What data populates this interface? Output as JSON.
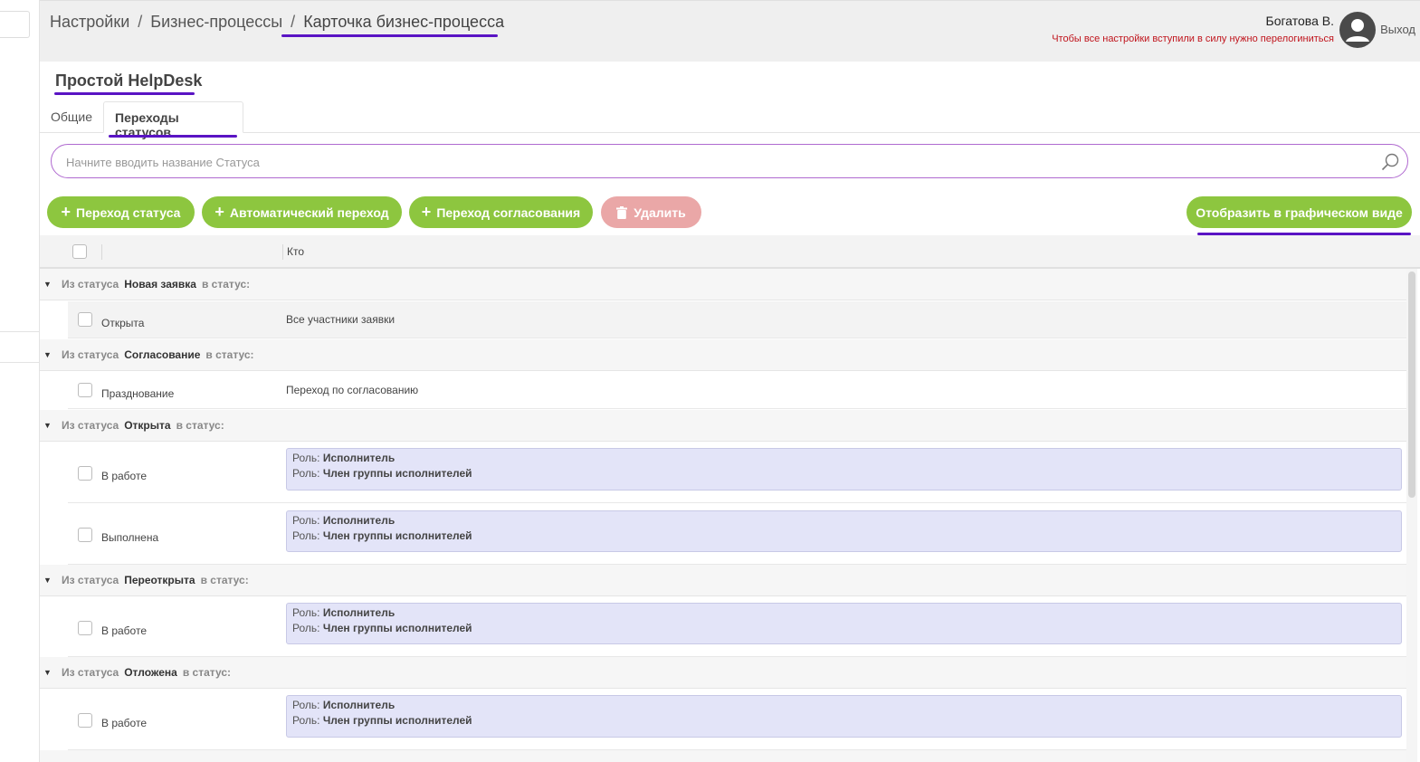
{
  "breadcrumb": {
    "item1": "Настройки",
    "item2": "Бизнес-процессы",
    "current": "Карточка бизнес-процесса",
    "separator": "/"
  },
  "user": {
    "name": "Богатова В.",
    "note": "Чтобы все настройки вступили в силу нужно перелогиниться",
    "logout": "Выход"
  },
  "page_title": "Простой HelpDesk",
  "tabs": [
    {
      "label": "Общие"
    },
    {
      "label": "Переходы статусов"
    }
  ],
  "search": {
    "placeholder": "Начните вводить название Статуса",
    "icon": "search-icon"
  },
  "toolbar": {
    "add_transition": "Переход статуса",
    "auto_transition": "Автоматический переход",
    "approval_transition": "Переход согласования",
    "delete": "Удалить",
    "graph_view": "Отобразить в графическом виде"
  },
  "table": {
    "col_who": "Кто",
    "from_label": "Из статуса",
    "to_label": "в статус:",
    "role_label": "Роль:",
    "groups": [
      {
        "from": "Новая заявка",
        "rows": [
          {
            "to": "Открыта",
            "who": "Все участники заявки"
          }
        ]
      },
      {
        "from": "Согласование",
        "rows": [
          {
            "to": "Празднование",
            "who": "Переход по согласованию"
          }
        ]
      },
      {
        "from": "Открыта",
        "rows": [
          {
            "to": "В работе",
            "roles": [
              "Исполнитель",
              "Член группы исполнителей"
            ]
          },
          {
            "to": "Выполнена",
            "roles": [
              "Исполнитель",
              "Член группы исполнителей"
            ]
          }
        ]
      },
      {
        "from": "Переоткрыта",
        "rows": [
          {
            "to": "В работе",
            "roles": [
              "Исполнитель",
              "Член группы исполнителей"
            ]
          }
        ]
      },
      {
        "from": "Отложена",
        "rows": [
          {
            "to": "В работе",
            "roles": [
              "Исполнитель",
              "Член группы исполнителей"
            ]
          }
        ]
      }
    ]
  },
  "colors": {
    "accent_green": "#8dc63f",
    "underline_purple": "#5a14c4",
    "search_border": "#b06ad0",
    "note_red": "#c0141c",
    "delete_disabled": "#eaa7a7",
    "rolebox_bg": "#e3e4f8"
  }
}
